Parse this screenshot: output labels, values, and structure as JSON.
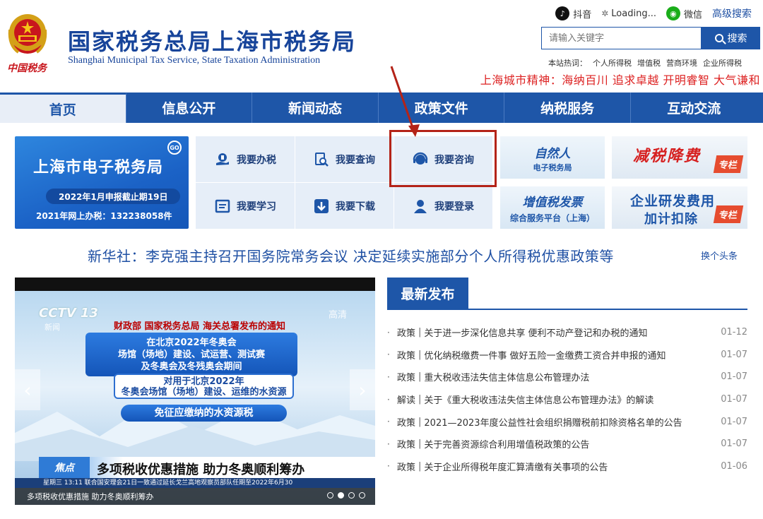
{
  "header": {
    "emblem_text": "中国税务",
    "title_cn": "国家税务总局上海市税务局",
    "title_en": "Shanghai Municipal Tax Service, State Taxation Administration",
    "top_links": {
      "douyin": "抖音",
      "loading": "Loading...",
      "wechat": "微信",
      "advanced_search": "高级搜索"
    },
    "search": {
      "placeholder": "请输入关键字",
      "button": "搜索"
    },
    "hot_label": "本站热词：",
    "hot_words": [
      "个人所得税",
      "增值税",
      "营商环境",
      "企业所得税"
    ],
    "spirit": "上海城市精神：海纳百川 追求卓越 开明睿智 大气谦和"
  },
  "nav": [
    "首页",
    "信息公开",
    "新闻动态",
    "政策文件",
    "纳税服务",
    "互动交流"
  ],
  "etax": {
    "title": "上海市电子税务局",
    "go": "GO",
    "deadline": "2022年1月申报截止期19日",
    "count": "2021年网上办税：132238058件"
  },
  "services": [
    "我要办税",
    "我要查询",
    "我要咨询",
    "我要学习",
    "我要下载",
    "我要登录"
  ],
  "promos": {
    "natural_person_1": "自然人",
    "natural_person_2": "电子税务局",
    "vat_1": "增值税发票",
    "vat_2": "综合服务平台（上海）",
    "tax_cut": "减税降费",
    "tax_cut_tag": "专栏",
    "rd_1": "企业研发费用",
    "rd_2": "加计扣除",
    "rd_tag": "专栏"
  },
  "headline": {
    "text": "新华社：李克强主持召开国务院常务会议 决定延续实施部分个人所得税优惠政策等",
    "change": "换个头条"
  },
  "video": {
    "cctv": "CCTV 13",
    "cctv_sub": "新闻",
    "hd": "高清",
    "notice": "财政部 国家税务总局 海关总署发布的通知",
    "box1": "在北京2022年冬奥会\n场馆（场地）建设、试运营、测试赛\n及冬奥会及冬残奥会期间",
    "box2": "对用于北京2022年\n冬奥会场馆（场地）建设、运维的水资源",
    "box3": "免征应缴纳的水资源税",
    "tag": "焦点",
    "caption": "多项税收优惠措施 助力冬奥顺利筹办",
    "ticker": "星期三 13:11 联合国安理会21日一致通过延长戈兰高地观察员部队任期至2022年6月30",
    "bottom_caption": "多项税收优惠措施 助力冬奥顺利筹办",
    "prev": "‹",
    "next": "›"
  },
  "latest": {
    "tab": "最新发布",
    "items": [
      {
        "cat": "政策",
        "title": "关于进一步深化信息共享 便利不动产登记和办税的通知",
        "date": "01-12"
      },
      {
        "cat": "政策",
        "title": "优化纳税缴费一件事 做好五险一金缴费工资合并申报的通知",
        "date": "01-07"
      },
      {
        "cat": "政策",
        "title": "重大税收违法失信主体信息公布管理办法",
        "date": "01-07"
      },
      {
        "cat": "解读",
        "title": "关于《重大税收违法失信主体信息公布管理办法》的解读",
        "date": "01-07"
      },
      {
        "cat": "政策",
        "title": "2021—2023年度公益性社会组织捐赠税前扣除资格名单的公告",
        "date": "01-07"
      },
      {
        "cat": "政策",
        "title": "关于完善资源综合利用增值税政策的公告",
        "date": "01-07"
      },
      {
        "cat": "政策",
        "title": "关于企业所得税年度汇算清缴有关事项的公告",
        "date": "01-06"
      }
    ]
  },
  "colors": {
    "brand_blue": "#1e56a8",
    "highlight_red": "#b42318",
    "spirit_red": "#dd2222"
  }
}
